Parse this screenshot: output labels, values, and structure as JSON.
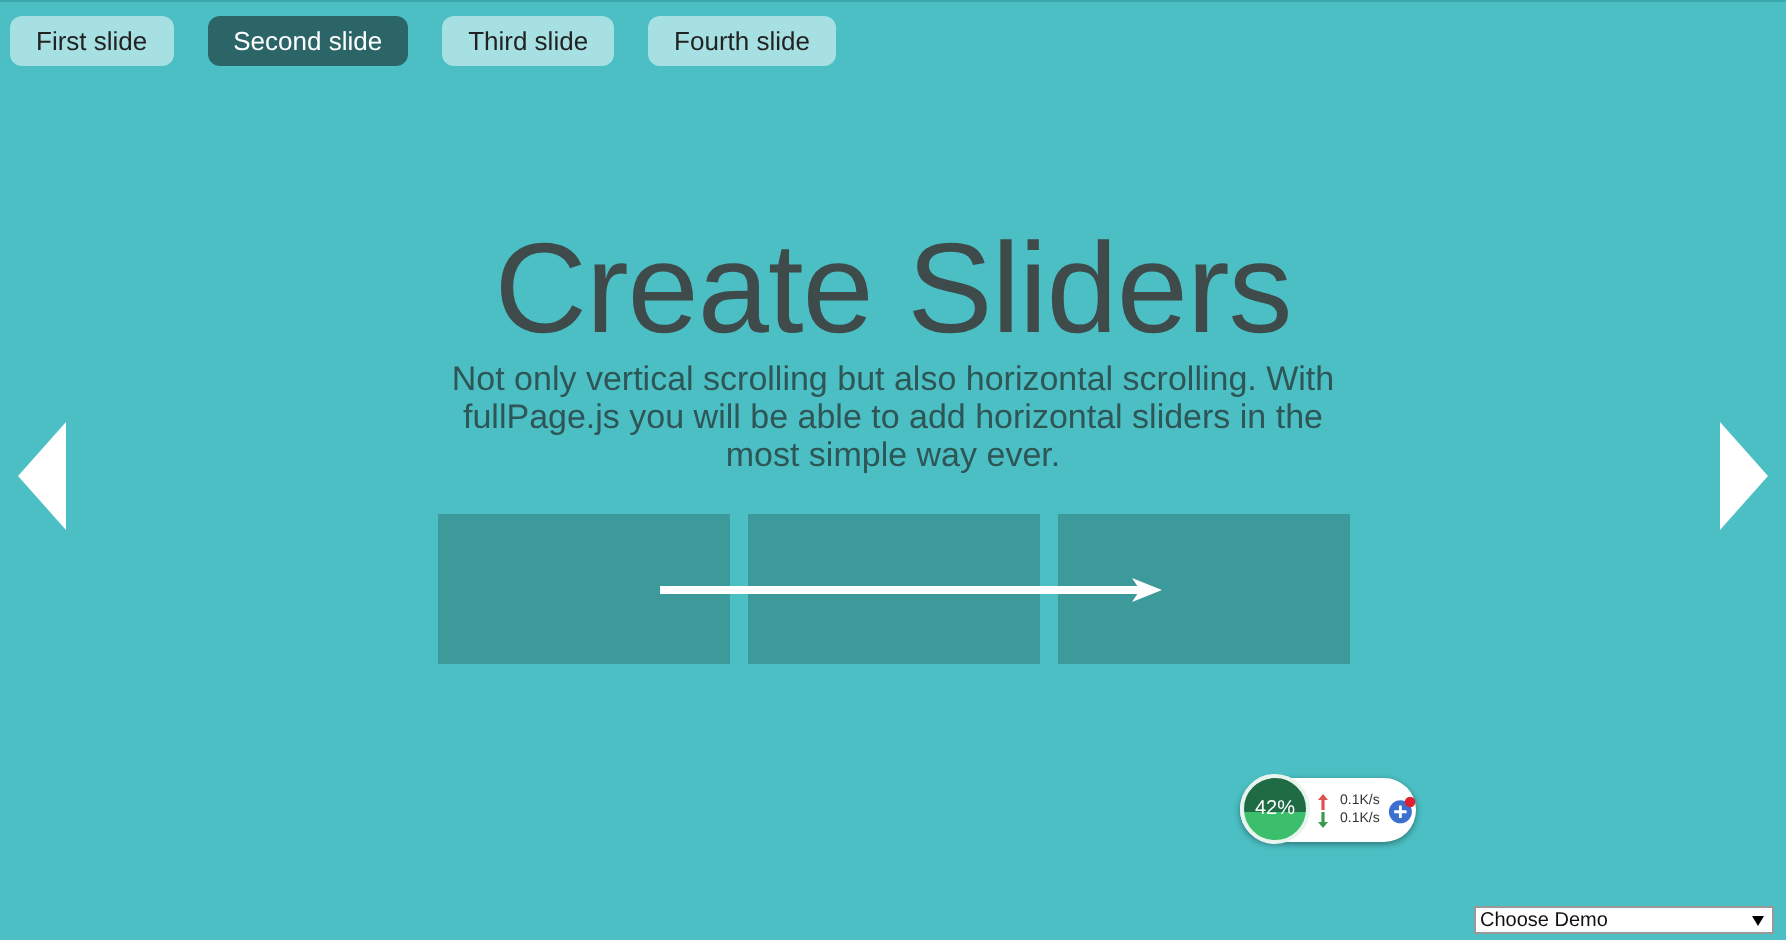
{
  "tabs": [
    {
      "label": "First slide",
      "selected": false
    },
    {
      "label": "Second slide",
      "selected": true
    },
    {
      "label": "Third slide",
      "selected": false
    },
    {
      "label": "Fourth slide",
      "selected": false
    }
  ],
  "heading": "Create Sliders",
  "description": "Not only vertical scrolling but also horizontal scrolling. With fullPage.js you will be able to add horizontal sliders in the most simple way ever.",
  "speed_widget": {
    "percent": "42%",
    "upload": "0.1K/s",
    "download": "0.1K/s"
  },
  "demo_select": {
    "value": "Choose Demo"
  }
}
